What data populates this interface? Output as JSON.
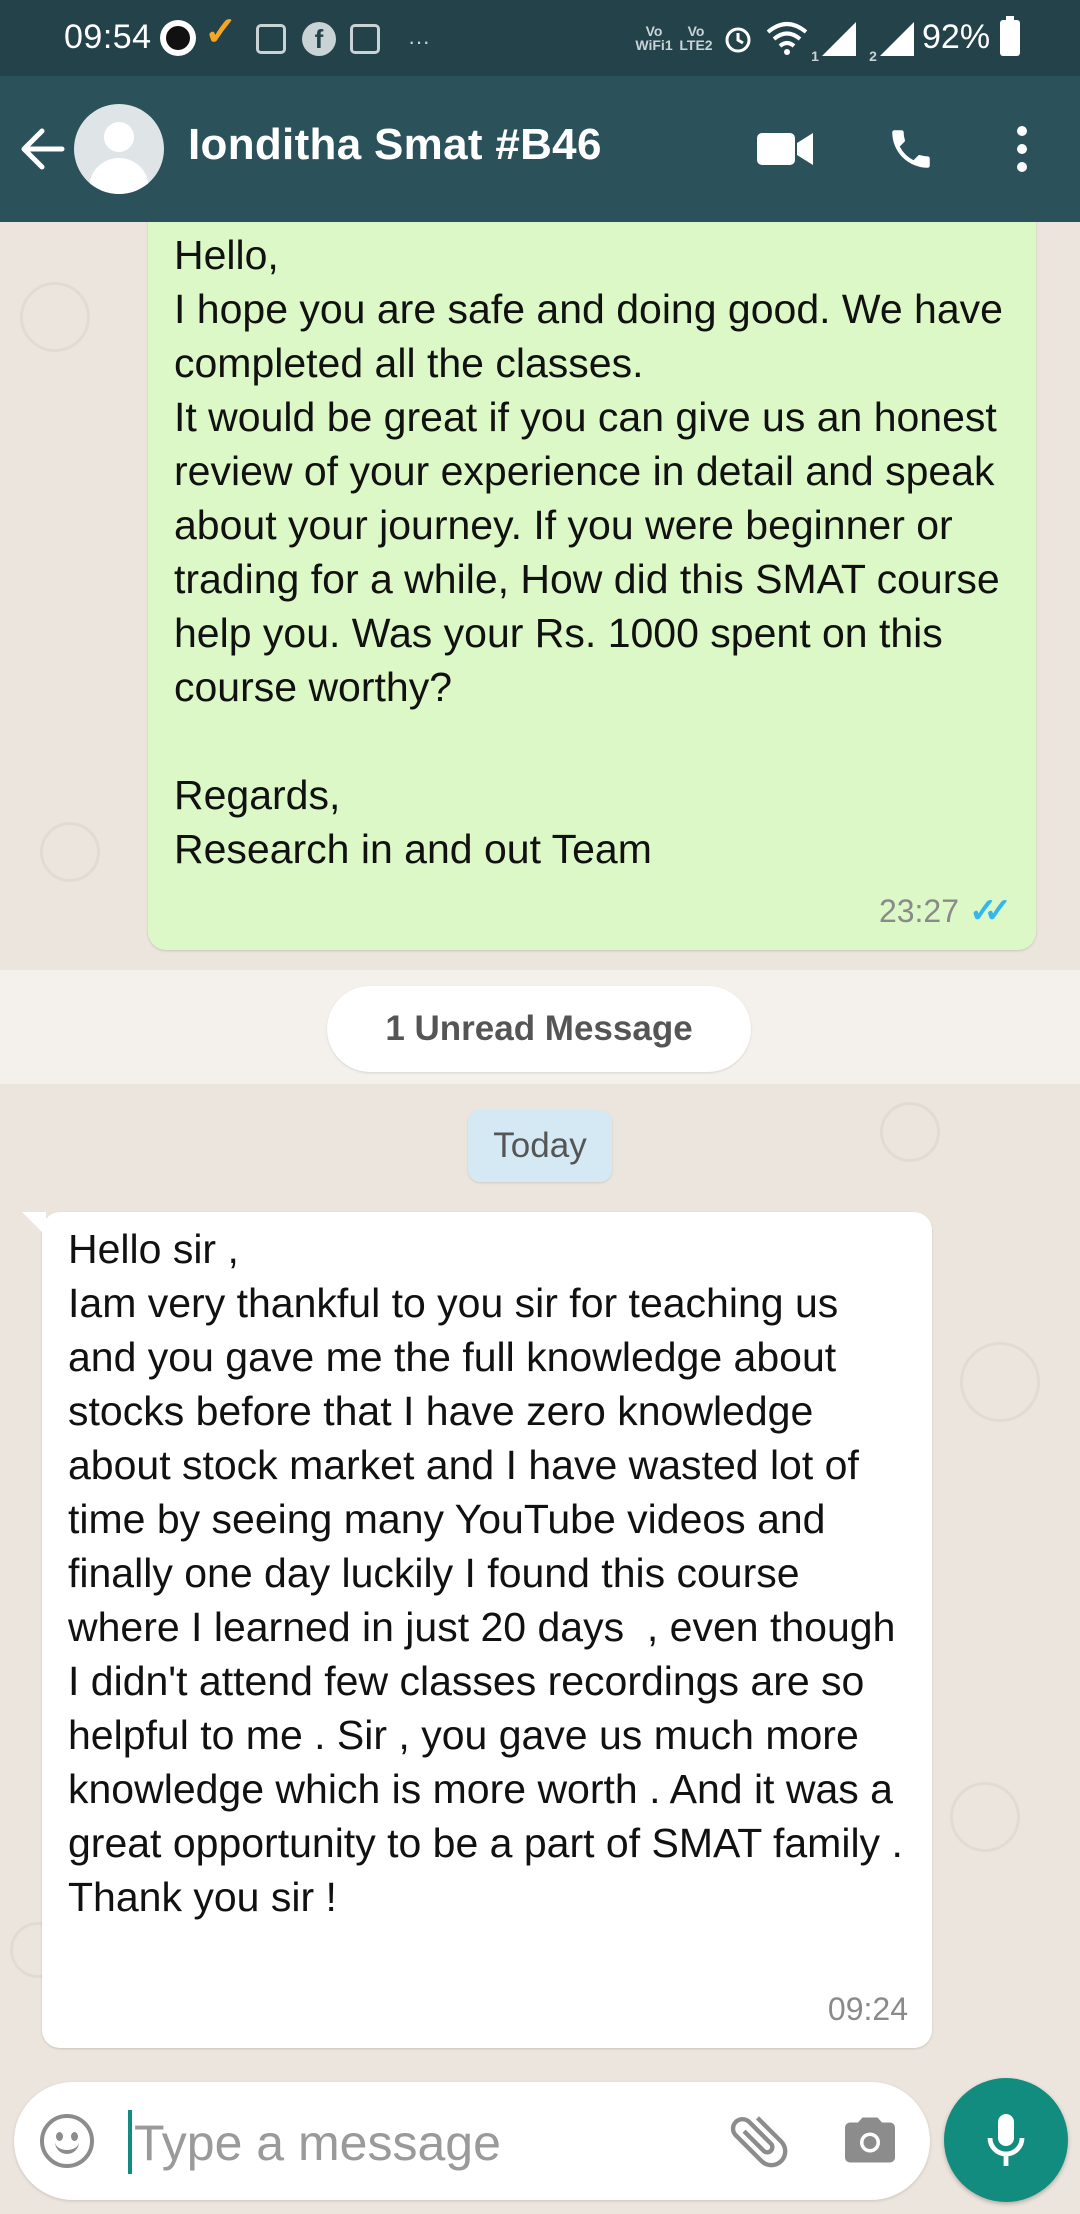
{
  "status_bar": {
    "time": "09:54",
    "volte1": "Vo WiFi1",
    "volte2": "Vo LTE2",
    "sim1": "1",
    "sim2": "2",
    "battery": "92%",
    "icons": [
      "app-icon",
      "check-icon",
      "m-icon",
      "facebook-icon",
      "calculator-icon",
      "more-dots-icon",
      "alarm-icon",
      "wifi-icon",
      "signal-icon",
      "battery-icon"
    ]
  },
  "header": {
    "contact_name": "Ionditha Smat #B46",
    "icons": [
      "back-arrow-icon",
      "avatar",
      "video-call-icon",
      "phone-icon",
      "more-vert-icon"
    ]
  },
  "messages": [
    {
      "direction": "outgoing",
      "text": "Hello,\nI hope you are safe and doing good. We have completed all the classes.\nIt would be great if you can give us an honest review of your experience in detail and speak about your journey. If you were beginner or trading for a while, How did this SMAT course help you. Was your Rs. 1000 spent on this course worthy?\n\nRegards,\nResearch in and out Team",
      "time": "23:27",
      "status": "read"
    },
    {
      "direction": "incoming",
      "text": "Hello sir ,\nIam very thankful to you sir for teaching us and you gave me the full knowledge about stocks before that I have zero knowledge about stock market and I have wasted lot of time by seeing many YouTube videos and finally one day luckily I found this course where I learned in just 20 days  , even though I didn't attend few classes recordings are so helpful to me . Sir , you gave us much more knowledge which is more worth . And it was a great opportunity to be a part of SMAT family .\nThank you sir !",
      "time": "09:24"
    }
  ],
  "unread_label": "1 Unread Message",
  "date_label": "Today",
  "composer": {
    "placeholder": "Type a message",
    "icons": [
      "emoji-icon",
      "attach-icon",
      "camera-icon",
      "mic-icon"
    ]
  },
  "colors": {
    "header": "#2b525a",
    "status_bar": "#23424a",
    "outgoing_bubble": "#dcf8c6",
    "incoming_bubble": "#ffffff",
    "accent": "#128c7e",
    "read_ticks": "#34b7f1",
    "chat_background": "#ece5dd"
  }
}
